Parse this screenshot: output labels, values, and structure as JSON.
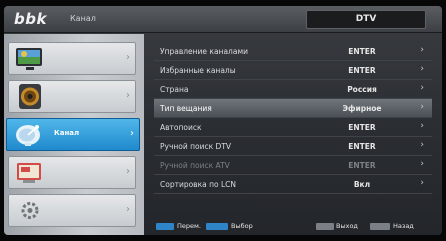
{
  "header": {
    "logo": "bbk",
    "title": "Канал",
    "source": "DTV"
  },
  "sidebar": {
    "items": [
      {
        "label": "",
        "icon": "picture-icon",
        "active": false
      },
      {
        "label": "",
        "icon": "sound-icon",
        "active": false
      },
      {
        "label": "Канал",
        "icon": "satellite-dish-icon",
        "active": true
      },
      {
        "label": "",
        "icon": "features-icon",
        "active": false
      },
      {
        "label": "",
        "icon": "setup-icon",
        "active": false
      }
    ]
  },
  "settings": {
    "rows": [
      {
        "label": "Управление каналами",
        "value": "ENTER",
        "selected": false,
        "disabled": false
      },
      {
        "label": "Избранные каналы",
        "value": "ENTER",
        "selected": false,
        "disabled": false
      },
      {
        "label": "Страна",
        "value": "Россия",
        "selected": false,
        "disabled": false
      },
      {
        "label": "Тип вещания",
        "value": "Эфирное",
        "selected": true,
        "disabled": false
      },
      {
        "label": "Автопоиск",
        "value": "ENTER",
        "selected": false,
        "disabled": false
      },
      {
        "label": "Ручной поиск DTV",
        "value": "ENTER",
        "selected": false,
        "disabled": false
      },
      {
        "label": "Ручной поиск ATV",
        "value": "ENTER",
        "selected": false,
        "disabled": true
      },
      {
        "label": "Сортировка по LCN",
        "value": "Вкл",
        "selected": false,
        "disabled": false
      }
    ]
  },
  "footer": {
    "move_label": "Перем.",
    "select_label": "Выбор",
    "exit_label": "Выход",
    "back_label": "Назад"
  },
  "colors": {
    "accent": "#2a97d9",
    "background": "#2b2e33"
  }
}
